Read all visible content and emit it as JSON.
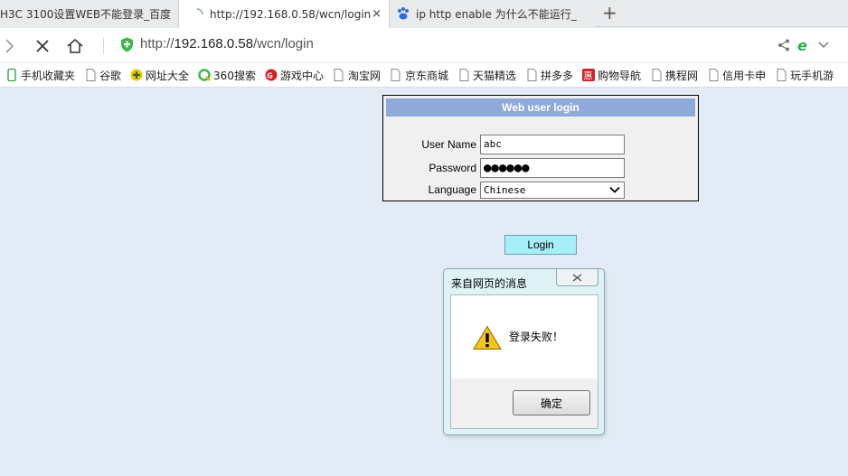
{
  "tabs": [
    {
      "label": "H3C 3100设置WEB不能登录_百度",
      "active": false
    },
    {
      "label": "http://192.168.0.58/wcn/login",
      "active": true
    },
    {
      "label": "ip http enable 为什么不能运行_",
      "active": false
    }
  ],
  "tab_close_glyph": "×",
  "new_tab_glyph": "+",
  "address": {
    "scheme": "http://",
    "host": "192.168.0.58",
    "path": "/wcn/login"
  },
  "bookmarks": [
    {
      "label": "手机收藏夹",
      "icon": "mobile-icon"
    },
    {
      "label": "谷歌",
      "icon": "page-icon"
    },
    {
      "label": "网址大全",
      "icon": "plus-circle-icon"
    },
    {
      "label": "360搜索",
      "icon": "search-ring-icon"
    },
    {
      "label": "游戏中心",
      "icon": "game-icon"
    },
    {
      "label": "淘宝网",
      "icon": "page-icon"
    },
    {
      "label": "京东商城",
      "icon": "page-icon"
    },
    {
      "label": "天猫精选",
      "icon": "page-icon"
    },
    {
      "label": "拼多多",
      "icon": "page-icon"
    },
    {
      "label": "购物导航",
      "icon": "hui-icon"
    },
    {
      "label": "携程网",
      "icon": "page-icon"
    },
    {
      "label": "信用卡申",
      "icon": "page-icon"
    },
    {
      "label": "玩手机游",
      "icon": "page-icon"
    }
  ],
  "login": {
    "header": "Web user login",
    "username_label": "User Name",
    "username_value": "abc",
    "password_label": "Password",
    "password_value": "●●●●●●",
    "language_label": "Language",
    "language_value": "Chinese",
    "button_label": "Login"
  },
  "dialog": {
    "title": "来自网页的消息",
    "message": "登录失败！",
    "ok_label": "确定"
  },
  "colors": {
    "page_bg": "#e3ecf6",
    "login_header": "#8eaad9",
    "login_button": "#a6eefa",
    "dialog_frame": "#dff3f6"
  }
}
